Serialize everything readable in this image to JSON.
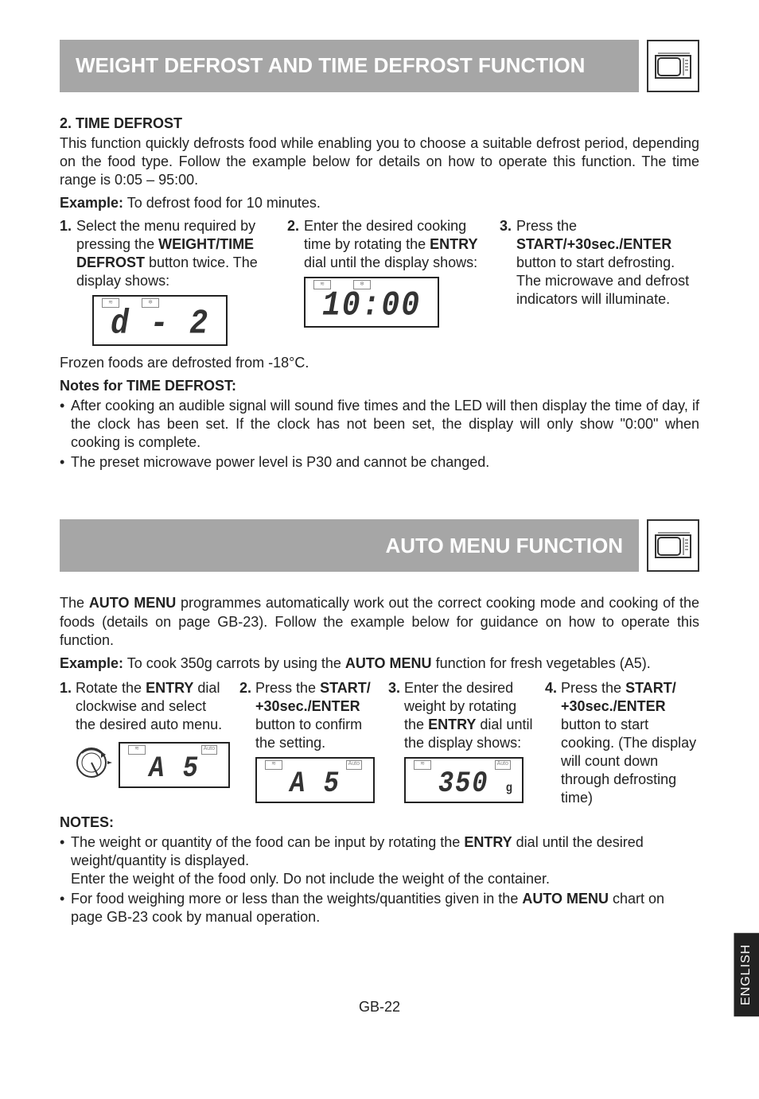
{
  "header1": {
    "title": "WEIGHT DEFROST AND TIME DEFROST FUNCTION"
  },
  "timeDefrost": {
    "title": "2.  TIME DEFROST",
    "intro": "This function quickly defrosts food while enabling you to choose a suitable defrost period, depending on the food type. Follow the example below for details on how to operate this function. The time range is 0:05 – 95:00.",
    "exampleLabel": "Example:",
    "exampleText": " To defrost food for 10 minutes.",
    "step1num": "1.",
    "step1a": "Select the menu required by pressing the ",
    "step1bold": "WEIGHT/TIME DEFROST",
    "step1b": " button twice. The display shows:",
    "disp1": "d - 2",
    "step2num": "2.",
    "step2a": "Enter the desired cooking time by rotating the ",
    "step2bold": "ENTRY",
    "step2b": " dial until the display shows:",
    "disp2": "10:00",
    "step3num": "3.",
    "step3a": "Press the ",
    "step3bold": "START/+30sec./ENTER",
    "step3b": " button to start defrosting. The microwave and defrost indicators will illuminate.",
    "frozen": "Frozen foods are defrosted from -18°C.",
    "notesTitle": "Notes for TIME DEFROST:",
    "note1": "After cooking an audible signal will sound five times and the LED will then display the time of day, if the clock has been set. If the clock has not been set, the display will only show \"0:00\" when cooking is complete.",
    "note2": "The preset microwave power level is P30 and cannot be changed."
  },
  "header2": {
    "title": "AUTO MENU FUNCTION"
  },
  "autoMenu": {
    "intro1a": "The ",
    "intro1bold": "AUTO MENU",
    "intro1b": " programmes automatically work out the correct cooking mode and cooking of the foods (details on page GB-23). Follow the example below for guidance on how to operate this function.",
    "exampleLabel": "Example:",
    "exampleA": " To cook 350g carrots by using the ",
    "exampleBold": "AUTO MENU",
    "exampleB": " function for fresh vegetables (A5).",
    "s1num": "1.",
    "s1a": "Rotate the ",
    "s1bold": "ENTRY",
    "s1b": " dial clockwise and select the desired auto menu.",
    "s1disp": "A 5",
    "s2num": "2.",
    "s2a": "Press the ",
    "s2bold": "START/ +30sec./ENTER",
    "s2b": " button to confirm the setting.",
    "s2disp": "A 5",
    "s3num": "3.",
    "s3a": "Enter the desired weight by rotating the ",
    "s3bold": "ENTRY",
    "s3b": " dial until the display shows:",
    "s3disp": "350",
    "s3g": "g",
    "s4num": "4.",
    "s4a": "Press the ",
    "s4bold": "START/ +30sec./ENTER",
    "s4b": " button to start cooking. (The display will count down through defrosting time)",
    "notesLabel": "NOTES:",
    "n1a": "The weight or quantity of the food can be input by rotating the ",
    "n1bold": "ENTRY",
    "n1b": " dial until the desired weight/quantity is displayed.",
    "n1c": "Enter the weight of the food only. Do not include the weight of the container.",
    "n2a": "For food weighing more or less than the weights/quantities given in the ",
    "n2bold": "AUTO MENU",
    "n2b": " chart on page GB-23 cook by manual operation."
  },
  "footer": {
    "page": "GB-22",
    "tab": "ENGLISH"
  },
  "icons": {
    "autoLabel": "Auto"
  }
}
